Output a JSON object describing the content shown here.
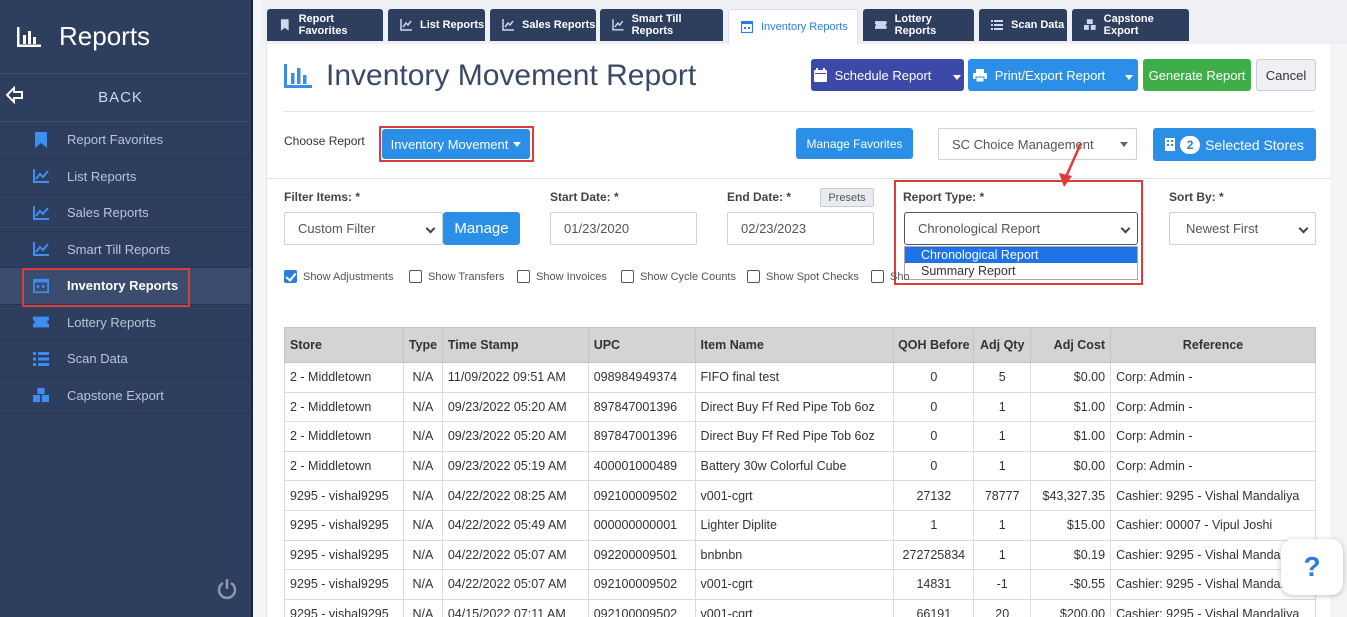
{
  "sidebar": {
    "title": "Reports",
    "back": "BACK",
    "items": [
      {
        "label": "Report Favorites"
      },
      {
        "label": "List Reports"
      },
      {
        "label": "Sales Reports"
      },
      {
        "label": "Smart Till Reports"
      },
      {
        "label": "Inventory Reports"
      },
      {
        "label": "Lottery Reports"
      },
      {
        "label": "Scan Data"
      },
      {
        "label": "Capstone Export"
      }
    ]
  },
  "tabs": [
    {
      "label": "Report Favorites"
    },
    {
      "label": "List Reports"
    },
    {
      "label": "Sales Reports"
    },
    {
      "label": "Smart Till Reports"
    },
    {
      "label": "Inventory Reports"
    },
    {
      "label": "Lottery Reports"
    },
    {
      "label": "Scan Data"
    },
    {
      "label": "Capstone Export"
    }
  ],
  "header": {
    "title": "Inventory Movement Report",
    "schedule": "Schedule Report",
    "print": "Print/Export Report",
    "generate": "Generate Report",
    "cancel": "Cancel"
  },
  "choose": {
    "label": "Choose Report",
    "value": "Inventory Movement",
    "manage_favorites": "Manage Favorites",
    "store_group": "SC Choice Management",
    "selected_count": "2",
    "selected_label": "Selected Stores"
  },
  "filters": {
    "filter_items_label": "Filter Items: *",
    "filter_items_value": "Custom Filter",
    "manage": "Manage",
    "start_label": "Start Date: *",
    "start_value": "01/23/2020",
    "end_label": "End Date: *",
    "end_value": "02/23/2023",
    "presets": "Presets",
    "report_type_label": "Report Type: *",
    "report_type_value": "Chronological Report",
    "report_type_options": [
      "Chronological Report",
      "Summary Report"
    ],
    "sort_label": "Sort By: *",
    "sort_value": "Newest First"
  },
  "checkboxes": [
    {
      "label": "Show Adjustments",
      "checked": true
    },
    {
      "label": "Show Transfers",
      "checked": false
    },
    {
      "label": "Show Invoices",
      "checked": false
    },
    {
      "label": "Show Cycle Counts",
      "checked": false
    },
    {
      "label": "Show Spot Checks",
      "checked": false
    },
    {
      "label": "Sho",
      "checked": false
    }
  ],
  "table": {
    "headers": [
      "Store",
      "Type",
      "Time Stamp",
      "UPC",
      "Item Name",
      "QOH Before",
      "Adj Qty",
      "Adj Cost",
      "Reference"
    ],
    "rows": [
      [
        "2 - Middletown",
        "N/A",
        "11/09/2022 09:51 AM",
        "098984949374",
        "FIFO final test",
        "0",
        "5",
        "$0.00",
        "Corp: Admin -"
      ],
      [
        "2 - Middletown",
        "N/A",
        "09/23/2022 05:20 AM",
        "897847001396",
        "Direct Buy Ff Red Pipe Tob 6oz",
        "0",
        "1",
        "$1.00",
        "Corp: Admin -"
      ],
      [
        "2 - Middletown",
        "N/A",
        "09/23/2022 05:20 AM",
        "897847001396",
        "Direct Buy Ff Red Pipe Tob 6oz",
        "0",
        "1",
        "$1.00",
        "Corp: Admin -"
      ],
      [
        "2 - Middletown",
        "N/A",
        "09/23/2022 05:19 AM",
        "400001000489",
        "Battery 30w Colorful Cube",
        "0",
        "1",
        "$0.00",
        "Corp: Admin -"
      ],
      [
        "9295 - vishal9295",
        "N/A",
        "04/22/2022 08:25 AM",
        "092100009502",
        "v001-cgrt",
        "27132",
        "78777",
        "$43,327.35",
        "Cashier: 9295 - Vishal Mandaliya"
      ],
      [
        "9295 - vishal9295",
        "N/A",
        "04/22/2022 05:49 AM",
        "000000000001",
        "Lighter Diplite",
        "1",
        "1",
        "$15.00",
        "Cashier: 00007 - Vipul Joshi"
      ],
      [
        "9295 - vishal9295",
        "N/A",
        "04/22/2022 05:07 AM",
        "092200009501",
        "bnbnbn",
        "272725834",
        "1",
        "$0.19",
        "Cashier: 9295 - Vishal Mandaliya"
      ],
      [
        "9295 - vishal9295",
        "N/A",
        "04/22/2022 05:07 AM",
        "092100009502",
        "v001-cgrt",
        "14831",
        "-1",
        "-$0.55",
        "Cashier: 9295 - Vishal Mandaliya"
      ],
      [
        "9295 - vishal9295",
        "N/A",
        "04/15/2022 07:11 AM",
        "092100009502",
        "v001-cgrt",
        "66191",
        "20",
        "$200.00",
        "Cashier: 9295 - Vishal Mandaliya"
      ]
    ]
  },
  "help": "?",
  "colors": {
    "sidebar": "#2d3e5f",
    "accent": "#2b7de0",
    "schedule": "#3b4aa8",
    "generate": "#3fae49",
    "highlight": "#e03a3a"
  }
}
